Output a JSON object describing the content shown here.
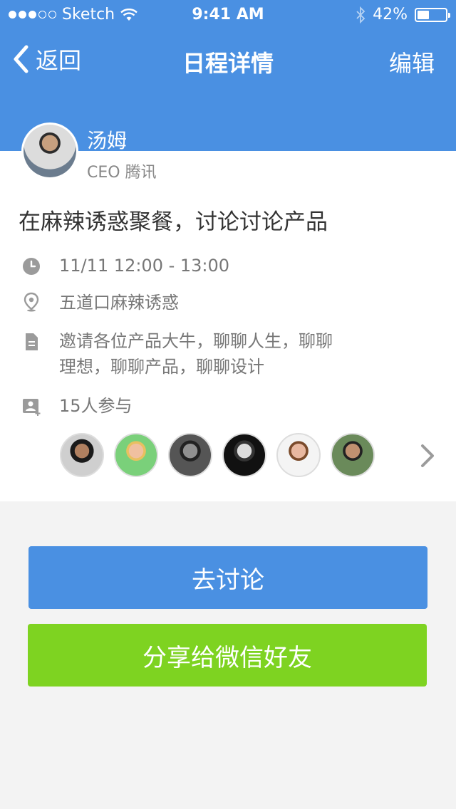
{
  "status_bar": {
    "carrier": "Sketch",
    "time": "9:41 AM",
    "battery": "42%",
    "battery_level": 0.42
  },
  "nav": {
    "back_label": "返回",
    "title": "日程详情",
    "edit_label": "编辑"
  },
  "organizer": {
    "name": "汤姆",
    "title": "CEO 腾讯"
  },
  "event": {
    "title": "在麻辣诱惑聚餐，讨论讨论产品",
    "datetime": "11/11  12:00 - 13:00",
    "location": "五道口麻辣诱惑",
    "description_line1": "邀请各位产品大牛，聊聊人生，聊聊",
    "description_line2": "理想，聊聊产品，聊聊设计",
    "participants_count": "15人参与"
  },
  "icons": {
    "time": "clock-icon",
    "location": "location-pin-icon",
    "description": "document-icon",
    "participants": "add-person-icon",
    "more": "chevron-right-icon"
  },
  "actions": {
    "discuss": "去讨论",
    "share": "分享给微信好友"
  },
  "colors": {
    "header": "#4a90e2",
    "discuss_button": "#4a90e2",
    "share_button": "#7ed321"
  }
}
